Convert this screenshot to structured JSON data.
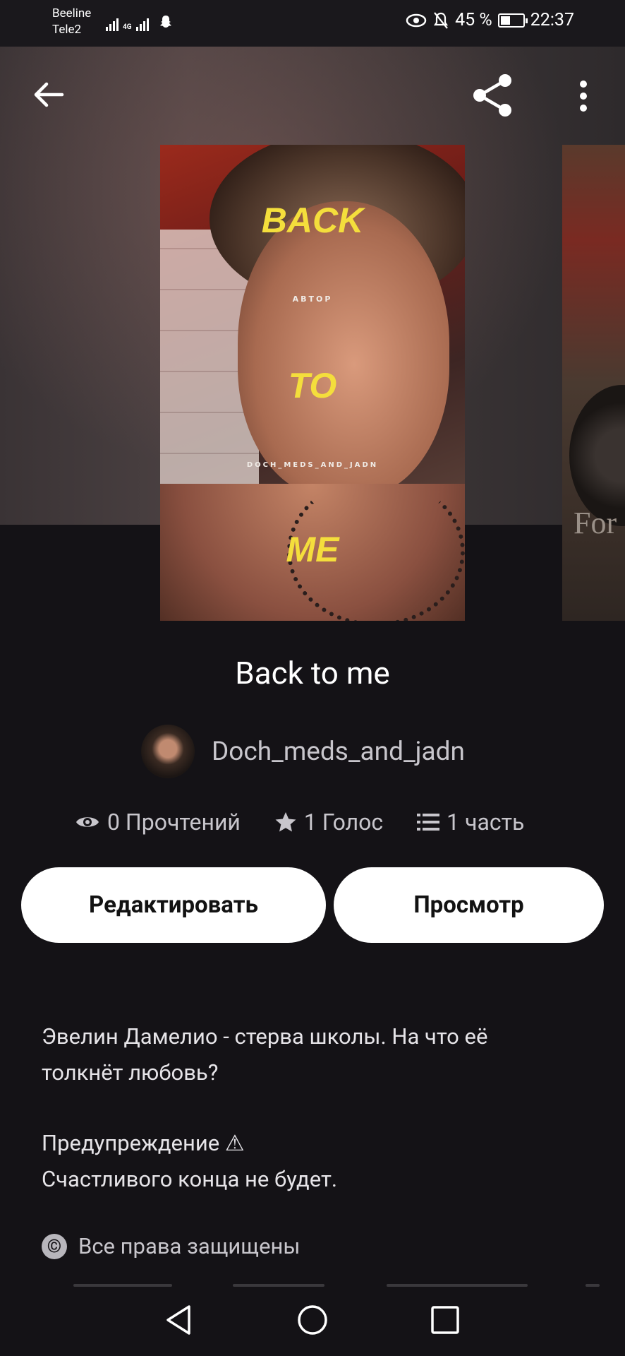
{
  "status_bar": {
    "carrier_1": "Beeline",
    "carrier_2": "Tele2",
    "network": "4G",
    "battery_text": "45 %",
    "battery_level": 0.45,
    "time": "22:37"
  },
  "toolbar": {
    "back_icon": "arrow-left-icon",
    "share_icon": "share-icon",
    "menu_icon": "more-vertical-icon"
  },
  "cover": {
    "line_1": "BACK",
    "author_label": "АВТОР",
    "line_2": "TO",
    "author_handle": "DOCH_MEDS_AND_JADN",
    "line_3": "ME"
  },
  "next_cover": {
    "text": "For"
  },
  "story": {
    "title": "Back to me",
    "author": "Doch_meds_and_jadn",
    "reads": "0 Прочтений",
    "votes": "1 Голос",
    "parts": "1 часть"
  },
  "actions": {
    "edit_label": "Редактировать",
    "view_label": "Просмотр"
  },
  "description": {
    "line_1": "Эвелин Дамелио - стерва школы. На что её",
    "line_2": "толкнёт любовь?",
    "line_3": "Предупреждение ⚠",
    "line_4": "Счастливого конца не будет."
  },
  "copyright": {
    "symbol": "©",
    "text": "Все права защищены"
  },
  "colors": {
    "background": "#141216",
    "button_bg": "#ffffff",
    "cover_title": "#f4de3c"
  }
}
